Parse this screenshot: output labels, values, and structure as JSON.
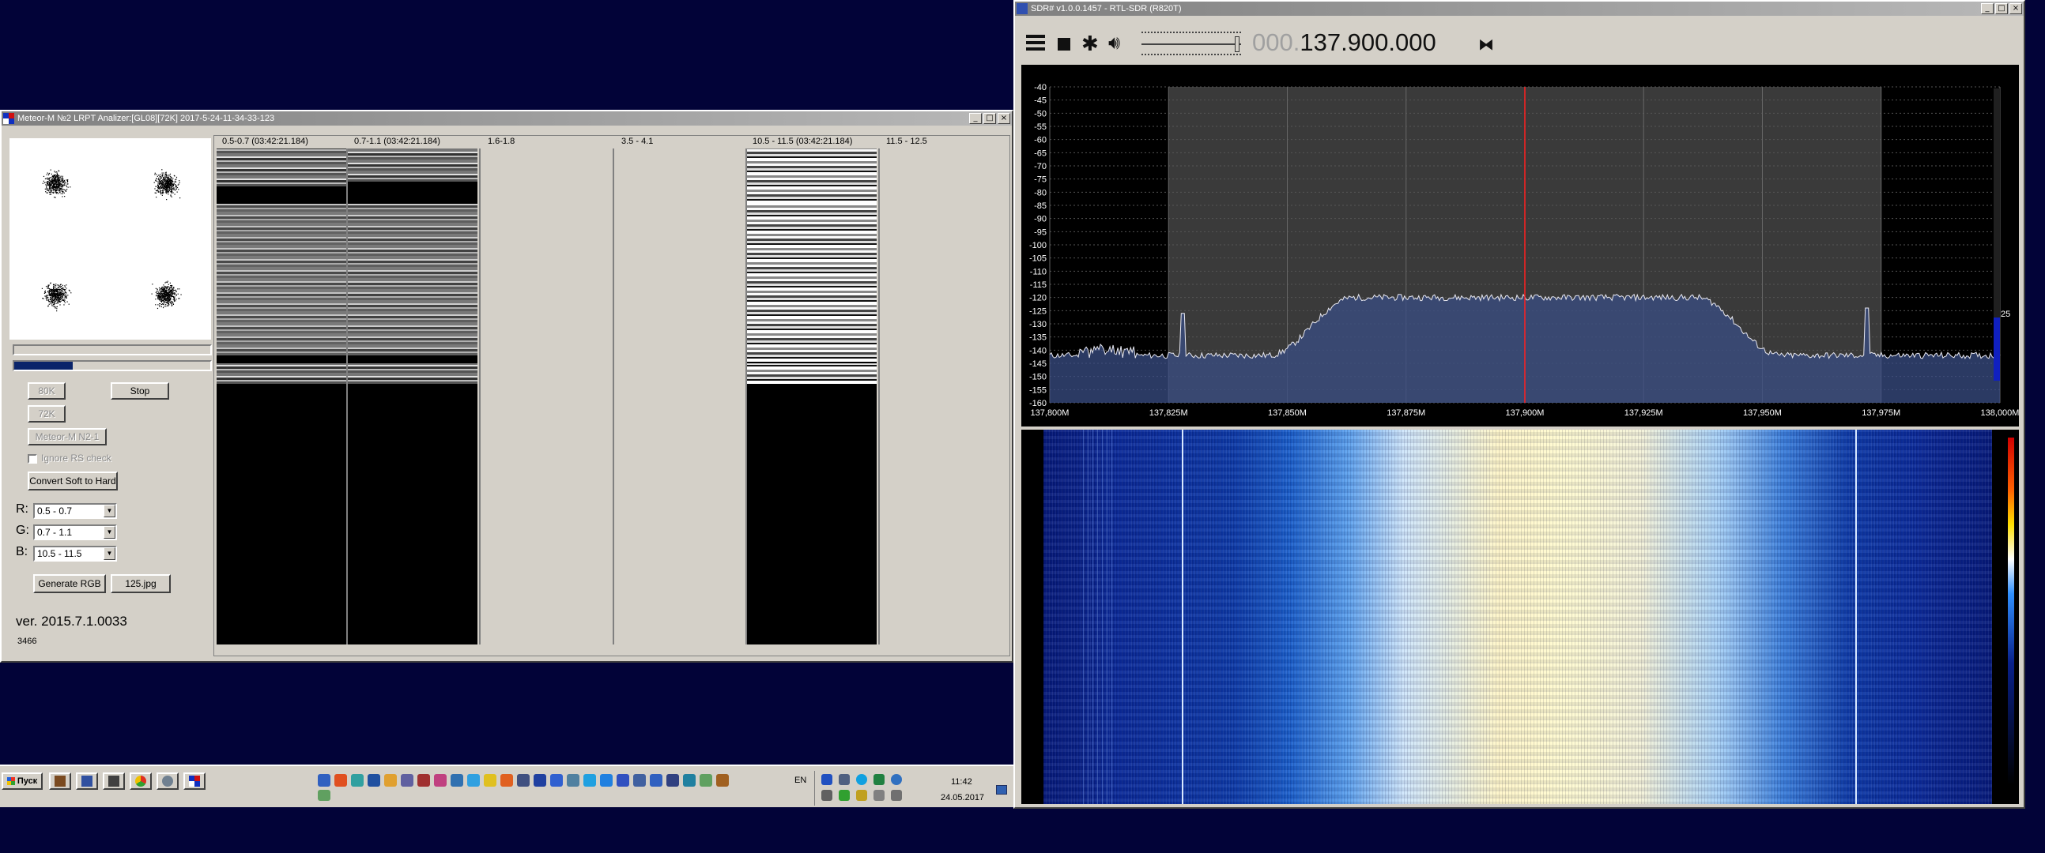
{
  "meteor": {
    "title": "Meteor-M №2 LRPT Analizer:[GL08][72K] 2017-5-24-11-34-33-123",
    "buttons": {
      "btn_80k": "80K",
      "btn_stop": "Stop",
      "btn_72k": "72K",
      "btn_meteor": "Meteor-M N2-1",
      "ignore_rs": "Ignore RS check",
      "convert": "Convert Soft to Hard",
      "generate_rgb": "Generate RGB",
      "jpg": "125.jpg"
    },
    "rgb": {
      "r_label": "R:",
      "r_value": "0.5 - 0.7",
      "g_label": "G:",
      "g_value": "0.7 - 1.1",
      "b_label": "B:",
      "b_value": "10.5 - 11.5"
    },
    "version": "ver. 2015.7.1.0033",
    "counter": "3466",
    "channels": [
      {
        "label": "0.5-0.7 (03:42:21.184)"
      },
      {
        "label": "0.7-1.1 (03:42:21.184)"
      },
      {
        "label": "1.6-1.8"
      },
      {
        "label": "3.5 - 4.1"
      },
      {
        "label": "10.5 - 11.5 (03:42:21.184)"
      },
      {
        "label": "11.5 - 12.5"
      }
    ],
    "progress_fraction": 0.3
  },
  "sdr": {
    "title": "SDR# v1.0.0.1457 - RTL-SDR (R820T)",
    "freq_dim": "000.",
    "freq_main": "137.900.000",
    "y_ticks": [
      "-40",
      "-45",
      "-50",
      "-55",
      "-60",
      "-65",
      "-70",
      "-75",
      "-80",
      "-85",
      "-90",
      "-95",
      "-100",
      "-105",
      "-110",
      "-115",
      "-120",
      "-125",
      "-130",
      "-135",
      "-140",
      "-145",
      "-150",
      "-155",
      "-160"
    ],
    "x_ticks": [
      "137,800M",
      "137,825M",
      "137,850M",
      "137,875M",
      "137,900M",
      "137,925M",
      "137,950M",
      "137,975M",
      "138,000M"
    ],
    "side_value": "25"
  },
  "taskbar": {
    "start_label": "Пуск",
    "lang": "EN",
    "time": "11:42",
    "date": "24.05.2017"
  },
  "colors": {
    "desktop": "#020338",
    "spectrum_fill": "#3a4d84",
    "center_line": "#ff2020",
    "waterfall_hot": "#fffbd0"
  }
}
